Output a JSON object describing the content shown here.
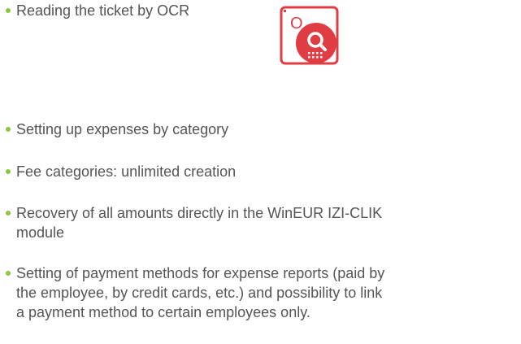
{
  "colors": {
    "bullet": "#8cc63f",
    "text": "#555555",
    "icon_red": "#e03c43"
  },
  "items": [
    {
      "text": "Reading the ticket by OCR"
    },
    {
      "text": "Setting up expenses by category"
    },
    {
      "text": "Fee categories: unlimited creation"
    },
    {
      "text": "Recovery of all amounts directly in the WinEUR IZI-CLIK\nmodule"
    },
    {
      "text": "Setting of payment methods for expense reports (paid by\nthe employee, by credit cards, etc.) and possibility to link\na payment method to certain employees only."
    }
  ],
  "icon": {
    "name": "ocr-search-icon",
    "letter": "O"
  }
}
